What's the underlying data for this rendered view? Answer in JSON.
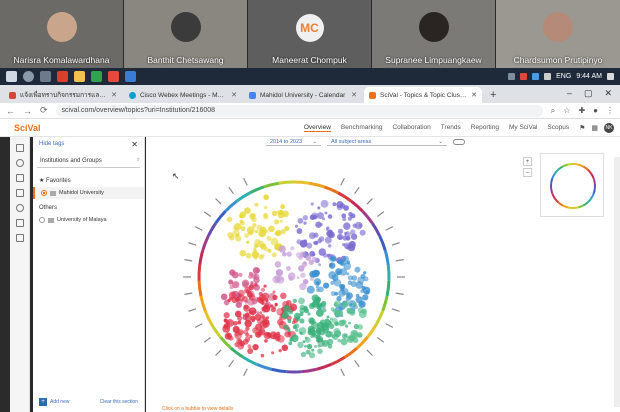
{
  "participants": [
    {
      "name": "Narisra Komalawardhana",
      "bg": "#6b6a66",
      "avatar": "#c9a58c"
    },
    {
      "name": "Banthit Chetsawang",
      "bg": "#8a8780",
      "avatar": "#3b3b3b"
    },
    {
      "name": "Maneerat Chompuk",
      "bg": "#5e5e5e",
      "initials": "MC"
    },
    {
      "name": "Supranee Limpuangkaew",
      "bg": "#7c7a76",
      "avatar": "#2a2522"
    },
    {
      "name": "Chardsumon Prutipinyo",
      "bg": "#9a9890",
      "avatar": "#b58a78"
    }
  ],
  "taskbar": {
    "lang": "ENG",
    "time": "9:44 AM"
  },
  "browser": {
    "tabs": [
      {
        "label": "แจ้งเพื่อทราบกิจกรรมการและเรื่องที่ผู้บริหาร",
        "color": "#d44638"
      },
      {
        "label": "Cisco Webex Meetings - Meetin",
        "color": "#00a0d1"
      },
      {
        "label": "Mahidol University - Calendar",
        "color": "#4285f4"
      },
      {
        "label": "SciVal - Topics & Topic Clusters",
        "color": "#e9711c",
        "active": true
      }
    ],
    "url": "scival.com/overview/topics?uri=Institution/216008"
  },
  "scival": {
    "logo": "SciVal",
    "nav": [
      "Overview",
      "Benchmarking",
      "Collaboration",
      "Trends",
      "Reporting",
      "My SciVal",
      "Scopus"
    ],
    "active_nav": "Overview",
    "user_initials": "NK"
  },
  "panel": {
    "hide_tags": "Hide tags",
    "search_placeholder": "Institutions and Groups",
    "favorites_label": "Favorites",
    "favorite_item": "Mahidol University",
    "others_label": "Others",
    "other_item": "University of Malaya",
    "add_new": "Add new",
    "clear": "Clear this section"
  },
  "filters": {
    "year_range": "2014 to 2023",
    "subject": "All subject areas"
  },
  "bottom_hint": "Click on a bubble to view details",
  "accent": "#e9711c"
}
